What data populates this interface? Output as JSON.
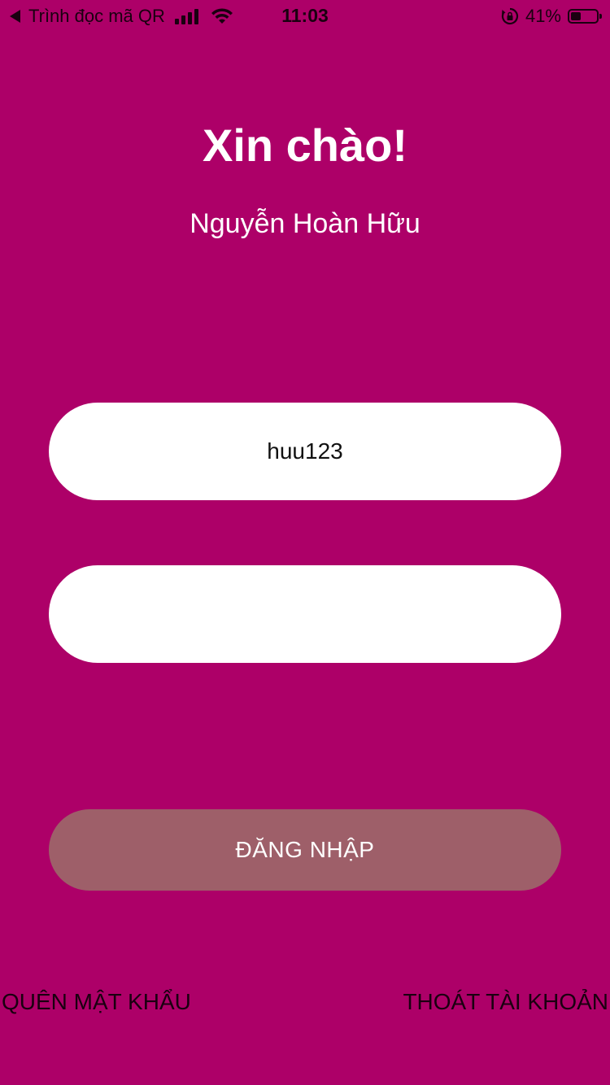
{
  "status_bar": {
    "back_label": "Trình đọc mã QR",
    "time": "11:03",
    "battery_percent": "41%",
    "battery_level": 0.41,
    "icons": [
      "back-triangle-icon",
      "signal-icon",
      "wifi-icon",
      "rotation-lock-icon",
      "battery-icon"
    ]
  },
  "header": {
    "greeting": "Xin chào!",
    "user_name": "Nguyễn Hoàn Hữu"
  },
  "form": {
    "username_value": "huu123",
    "password_value": "",
    "login_label": "ĐĂNG NHẬP"
  },
  "links": {
    "forgot_password": "QUÊN MẬT KHẨU",
    "logout": "THOÁT TÀI KHOẢN"
  },
  "colors": {
    "background": "#ad0068",
    "field_background": "#ffffff",
    "login_button": "#9e5f69",
    "link_text": "#1a0010"
  }
}
